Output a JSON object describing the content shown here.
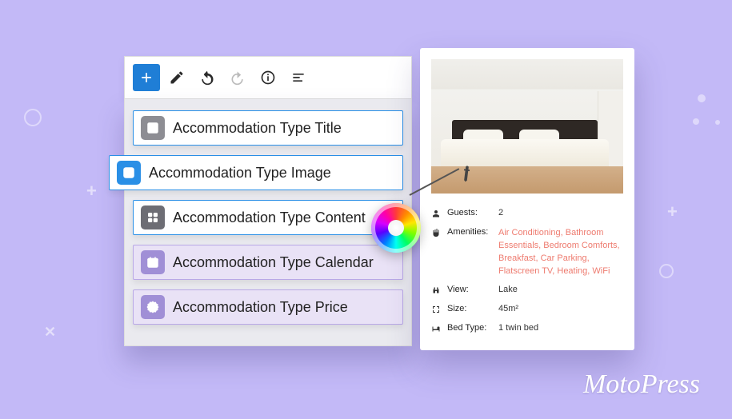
{
  "toolbar": {
    "add": "add",
    "edit": "edit",
    "undo": "undo",
    "redo": "redo",
    "info": "info",
    "outline": "outline"
  },
  "blocks": [
    {
      "icon": "pencil-square",
      "label": "Accommodation Type Title"
    },
    {
      "icon": "image",
      "label": "Accommodation Type Image"
    },
    {
      "icon": "grid",
      "label": "Accommodation Type Content"
    },
    {
      "icon": "calendar",
      "label": "Accommodation Type Calendar"
    },
    {
      "icon": "badge-percent",
      "label": "Accommodation Type Price"
    }
  ],
  "preview": {
    "specs": {
      "guests": {
        "label": "Guests:",
        "value": "2"
      },
      "amenities": {
        "label": "Amenities:",
        "value": "Air Conditioning, Bathroom Essentials, Bedroom Comforts, Breakfast, Car Parking, Flatscreen TV, Heating, WiFi"
      },
      "view": {
        "label": "View:",
        "value": "Lake"
      },
      "size": {
        "label": "Size:",
        "value": "45m²"
      },
      "bedtype": {
        "label": "Bed Type:",
        "value": "1 twin bed"
      }
    }
  },
  "brand": "MotoPress"
}
